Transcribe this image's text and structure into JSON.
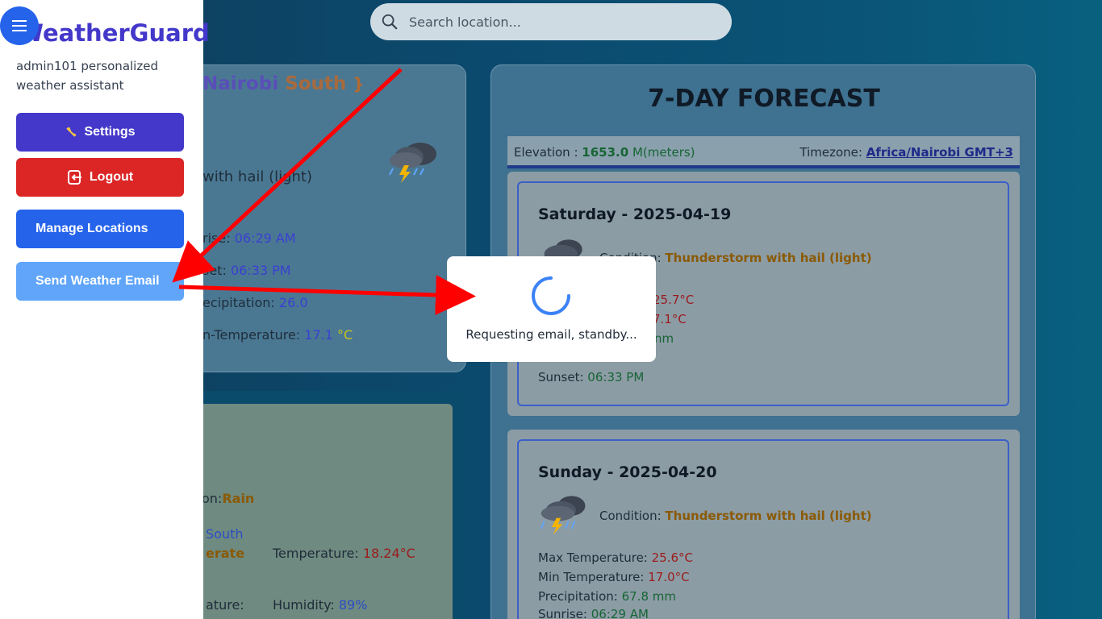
{
  "search": {
    "placeholder": "Search location..."
  },
  "sidebar": {
    "brand": "WeatherGuard",
    "subtitle": "admin101 personalized weather assistant",
    "buttons": {
      "settings": "Settings",
      "logout": "Logout",
      "manage_locations": "Manage Locations",
      "send_email": "Send Weather Email"
    }
  },
  "current": {
    "title_part1": "Nairobi",
    "title_part2": "South",
    "title_bracket": "}",
    "condition": "with hail (light)",
    "sunrise_label": "rise:",
    "sunrise_value": "06:29 AM",
    "sunset_label": "set:",
    "sunset_value": "06:33 PM",
    "precip_label": "ecipitation:",
    "precip_value": "26.0",
    "mintemp_label": "n-Temperature:",
    "mintemp_value": "17.1",
    "mintemp_unit": "°C"
  },
  "lower": {
    "cond_label": "on:",
    "cond_value": "Rain",
    "location": "South",
    "severity": "erate",
    "temp_label": "Temperature:",
    "temp_value": "18.24°C",
    "feels_label": "ature:",
    "humidity_label": "Humidity:",
    "humidity_value": "89%"
  },
  "forecast": {
    "title": "7-DAY FORECAST",
    "elevation_label": "Elevation :",
    "elevation_value": "1653.0",
    "elevation_unit": "M(meters)",
    "timezone_label": "Timezone:",
    "timezone_value": "Africa/Nairobi GMT+3",
    "days": [
      {
        "title": "Saturday - 2025-04-19",
        "condition_label": "Condition:",
        "condition": "Thunderstorm with hail (light)",
        "max_temp": "25.7°C",
        "min_temp": "7.1°C",
        "precip": "nm",
        "sunset_label": "Sunset:",
        "sunset": "06:33 PM"
      },
      {
        "title": "Sunday - 2025-04-20",
        "condition_label": "Condition:",
        "condition": "Thunderstorm with hail (light)",
        "max_label": "Max Temperature:",
        "max_temp": "25.6°C",
        "min_label": "Min Temperature:",
        "min_temp": "17.0°C",
        "precip_label": "Precipitation:",
        "precip": "67.8 mm",
        "sunrise_label": "Sunrise:",
        "sunrise": "06:29 AM"
      }
    ]
  },
  "modal": {
    "message": "Requesting email, standby..."
  },
  "colors": {
    "brand": "#4338ca",
    "logout": "#dc2626",
    "primary": "#2563eb",
    "send": "#60a5fa",
    "arrow": "#ff0000"
  }
}
